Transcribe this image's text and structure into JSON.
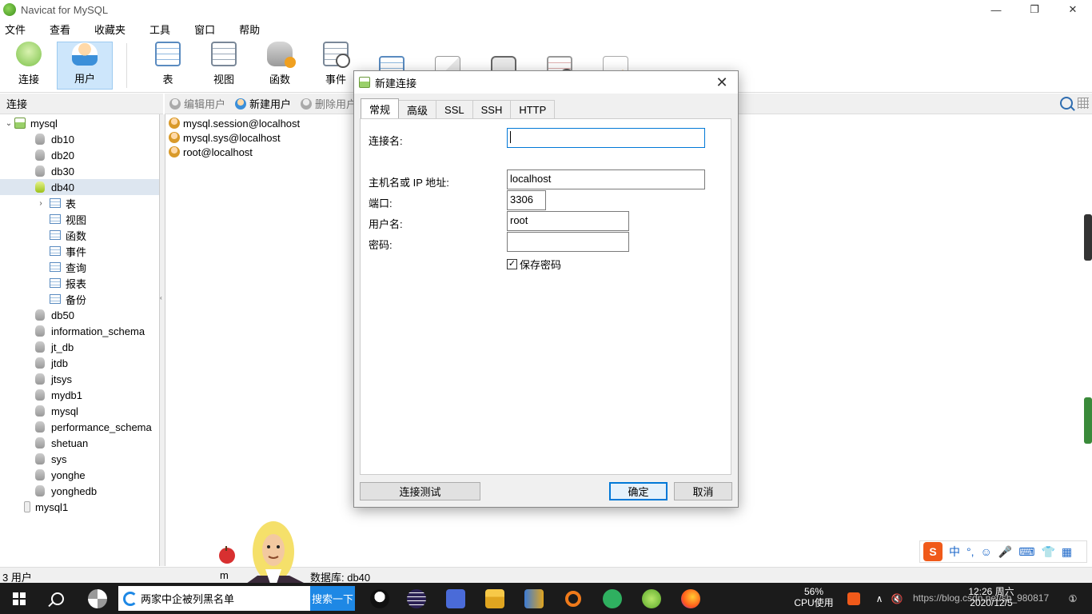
{
  "window": {
    "title": "Navicat for MySQL",
    "min": "—",
    "max": "❐",
    "close": "✕"
  },
  "menu": [
    "文件",
    "查看",
    "收藏夹",
    "工具",
    "窗口",
    "帮助"
  ],
  "toolbar": {
    "buttons": [
      {
        "label": "连接",
        "icon": "connection-icon"
      },
      {
        "label": "用户",
        "icon": "user-icon",
        "active": true
      },
      {
        "label": "表",
        "icon": "table-icon"
      },
      {
        "label": "视图",
        "icon": "view-icon"
      },
      {
        "label": "函数",
        "icon": "function-icon"
      },
      {
        "label": "事件",
        "icon": "event-icon"
      },
      {
        "label": "",
        "icon": "query-icon"
      },
      {
        "label": "",
        "icon": "report-icon"
      },
      {
        "label": "",
        "icon": "backup-icon"
      },
      {
        "label": "",
        "icon": "schedule-icon"
      },
      {
        "label": "",
        "icon": "model-icon"
      }
    ]
  },
  "left_panel": {
    "header": "连接",
    "tree": [
      {
        "label": "mysql",
        "type": "connection",
        "expanded": true,
        "level": 0
      },
      {
        "label": "db10",
        "type": "db",
        "level": 1
      },
      {
        "label": "db20",
        "type": "db",
        "level": 1
      },
      {
        "label": "db30",
        "type": "db",
        "level": 1
      },
      {
        "label": "db40",
        "type": "db-open",
        "level": 1,
        "selected": true
      },
      {
        "label": "表",
        "type": "obj",
        "level": 2,
        "caret": "›"
      },
      {
        "label": "视图",
        "type": "obj",
        "level": 2
      },
      {
        "label": "函数",
        "type": "obj",
        "level": 2
      },
      {
        "label": "事件",
        "type": "obj",
        "level": 2
      },
      {
        "label": "查询",
        "type": "obj",
        "level": 2
      },
      {
        "label": "报表",
        "type": "obj",
        "level": 2
      },
      {
        "label": "备份",
        "type": "obj",
        "level": 2
      },
      {
        "label": "db50",
        "type": "db",
        "level": 1
      },
      {
        "label": "information_schema",
        "type": "db",
        "level": 1
      },
      {
        "label": "jt_db",
        "type": "db",
        "level": 1
      },
      {
        "label": "jtdb",
        "type": "db",
        "level": 1
      },
      {
        "label": "jtsys",
        "type": "db",
        "level": 1
      },
      {
        "label": "mydb1",
        "type": "db",
        "level": 1
      },
      {
        "label": "mysql",
        "type": "db",
        "level": 1
      },
      {
        "label": "performance_schema",
        "type": "db",
        "level": 1
      },
      {
        "label": "shetuan",
        "type": "db",
        "level": 1
      },
      {
        "label": "sys",
        "type": "db",
        "level": 1
      },
      {
        "label": "yonghe",
        "type": "db",
        "level": 1
      },
      {
        "label": "yonghedb",
        "type": "db",
        "level": 1
      },
      {
        "label": "mysql1",
        "type": "connection-off",
        "level": 0
      }
    ]
  },
  "object_toolbar": {
    "edit": "编辑用户",
    "new": "新建用户",
    "delete": "删除用户"
  },
  "users": [
    "mysql.session@localhost",
    "mysql.sys@localhost",
    "root@localhost"
  ],
  "statusbar": {
    "count": "3 用户",
    "conn": "m",
    "db": "数据库: db40"
  },
  "dialog": {
    "title": "新建连接",
    "close": "✕",
    "tabs": [
      "常规",
      "高级",
      "SSL",
      "SSH",
      "HTTP"
    ],
    "active_tab": "常规",
    "fields": {
      "conn_name_label": "连接名:",
      "conn_name_value": "",
      "host_label": "主机名或 IP 地址:",
      "host_value": "localhost",
      "port_label": "端口:",
      "port_value": "3306",
      "user_label": "用户名:",
      "user_value": "root",
      "pass_label": "密码:",
      "pass_value": "",
      "save_pass_label": "保存密码",
      "save_pass_checked": true
    },
    "buttons": {
      "test": "连接测试",
      "ok": "确定",
      "cancel": "取消"
    }
  },
  "ime": {
    "logo": "S",
    "lang": "中",
    "punct": "°,",
    "emoji": "☺",
    "mic": "🎤",
    "kbd": "⌨",
    "skin": "👕",
    "grid": "▦"
  },
  "taskbar": {
    "search_text": "两家中企被列黑名单",
    "search_button": "搜索一下",
    "cpu_percent": "56%",
    "cpu_label": "CPU使用",
    "time": "12:26 周六",
    "date": "2020/12/5",
    "watermark": "https://blog.csdn.net/sh_980817"
  }
}
